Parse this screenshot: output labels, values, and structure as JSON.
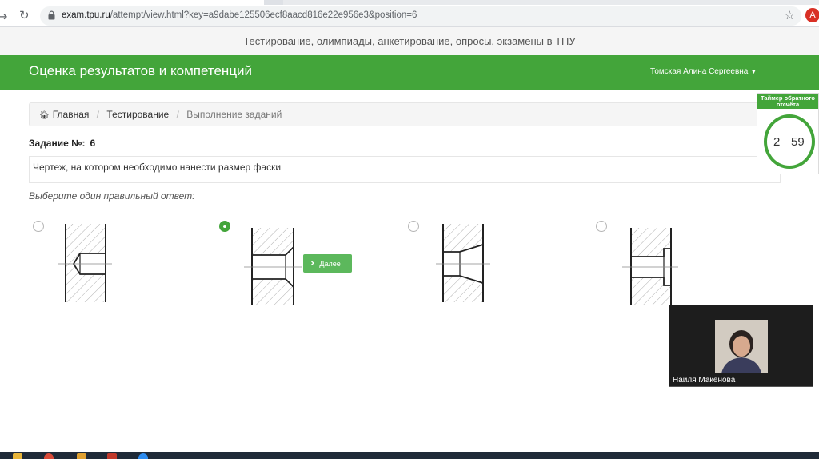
{
  "browser": {
    "url_host": "exam.tpu.ru",
    "url_path": "/attempt/view.html?key=a9dabe125506ecf8aacd816e22e956e3&position=6",
    "profile_initial": "A"
  },
  "site": {
    "tagline": "Тестирование, олимпиады, анкетирование, опросы, экзамены в ТПУ",
    "brand": "Оценка результатов и компетенций",
    "user_name": "Томская Алина Сергеевна",
    "accent_color": "#43a53a"
  },
  "breadcrumb": {
    "items": [
      "Главная",
      "Тестирование",
      "Выполнение заданий"
    ]
  },
  "task": {
    "label": "Задание №:",
    "number": "6",
    "question": "Чертеж, на котором необходимо нанести размер фаски",
    "prompt": "Выберите один правильный ответ:",
    "selected_option": 2,
    "next_label": "Далее"
  },
  "timer": {
    "title": "Таймер обратного отсчёта",
    "minutes": "2",
    "seconds": "59"
  },
  "video": {
    "participant_name": "Наиля Макенова"
  },
  "icons": {
    "home": "home-icon",
    "lock": "lock-icon",
    "star": "star-icon",
    "reload": "reload-icon",
    "back": "back-arrow-icon",
    "next": "chevron-right-icon"
  }
}
